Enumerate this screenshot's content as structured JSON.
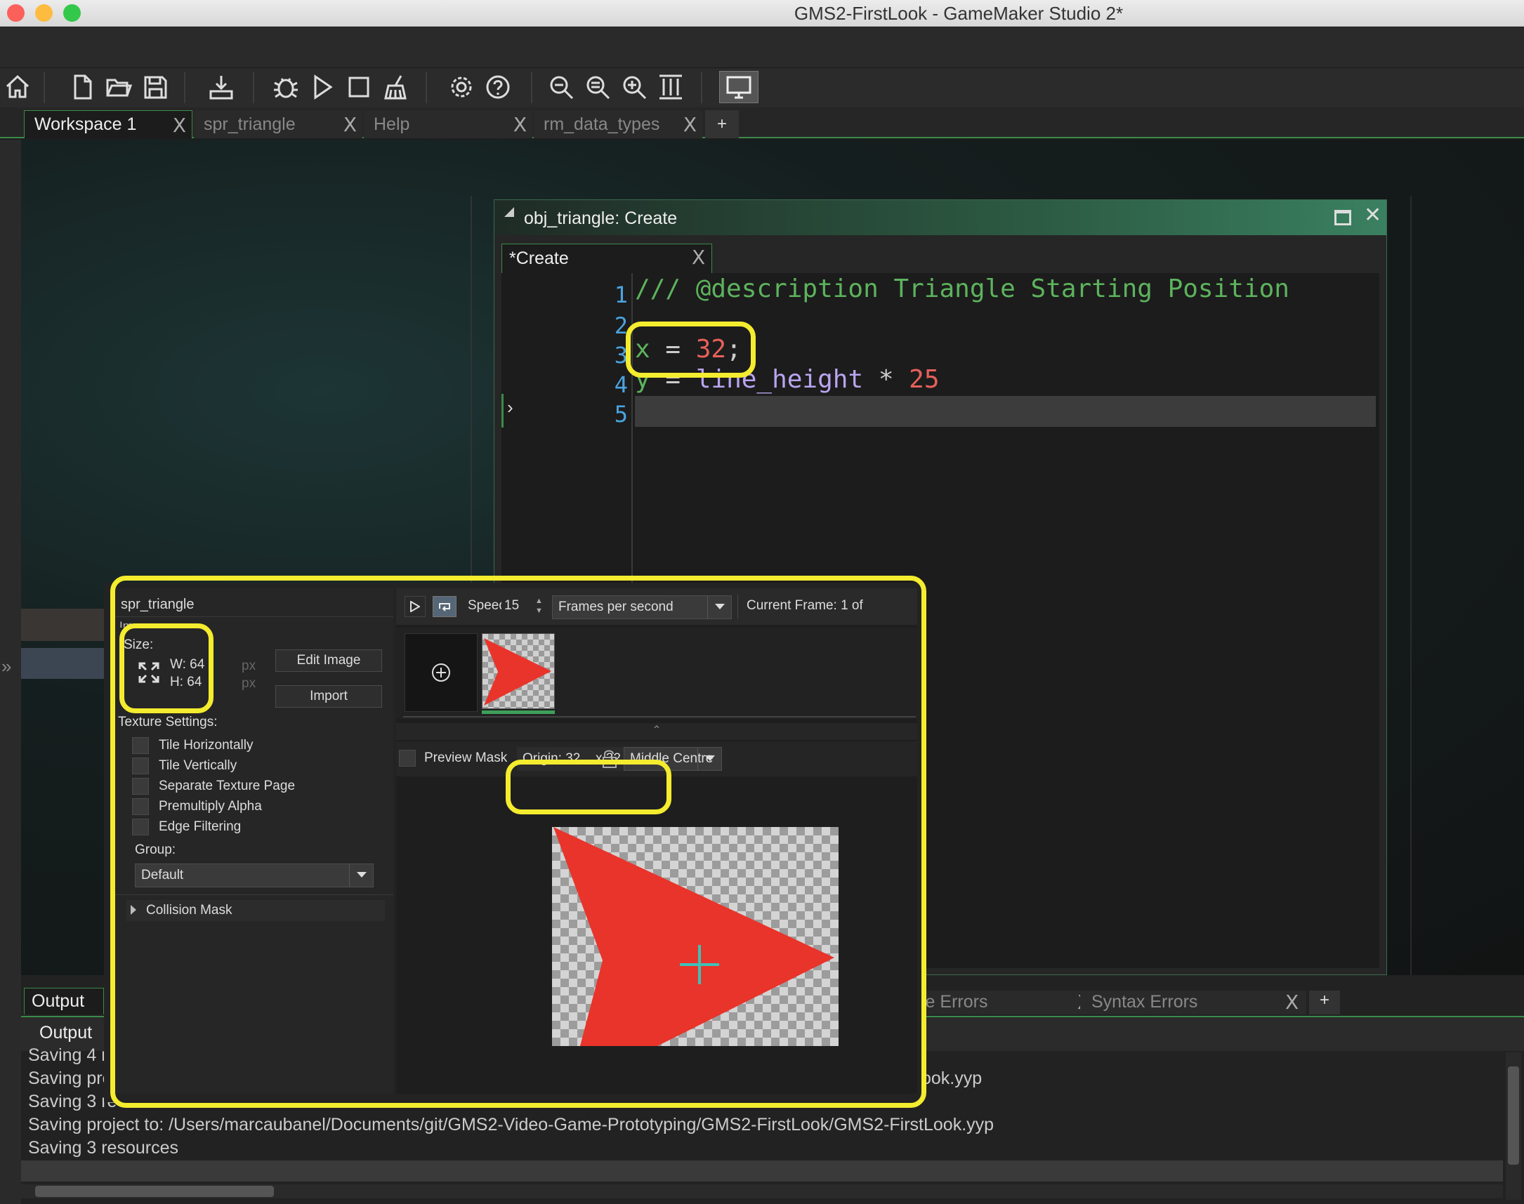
{
  "window": {
    "title": "GMS2-FirstLook - GameMaker Studio 2*"
  },
  "toolbar": {
    "icons": [
      "home-icon",
      "new-file-icon",
      "open-folder-icon",
      "save-icon",
      "export-icon",
      "debug-icon",
      "run-icon",
      "stop-icon",
      "clean-icon",
      "settings-icon",
      "help-icon",
      "zoom-out-icon",
      "zoom-reset-icon",
      "zoom-in-icon",
      "fit-icon",
      "display-icon"
    ]
  },
  "workspace_tabs": [
    {
      "label": "Workspace 1",
      "close": "X"
    },
    {
      "label": "spr_triangle",
      "close": "X"
    },
    {
      "label": "Help",
      "close": "X"
    },
    {
      "label": "rm_data_types",
      "close": "X"
    }
  ],
  "add_tab": "+",
  "side_arrow": "»",
  "code_window": {
    "title": "obj_triangle: Create",
    "tab": "*Create",
    "tab_close": "X",
    "caret_marker": "›",
    "line_numbers": [
      "1",
      "2",
      "3",
      "4",
      "5"
    ],
    "comment": "/// @description Triangle Starting Position",
    "line3_var": "x",
    "line3_op": " = ",
    "line3_num": "32",
    "line3_end": ";",
    "line4_var": "y",
    "line4_op": " = ",
    "line4_ident": "line_height",
    "line4_mul": " * ",
    "line4_num": "25"
  },
  "sprite": {
    "name": "spr_triangle",
    "image_label": "Image:",
    "size_label": "Size:",
    "width": "W: 64",
    "height": "H: 64",
    "px1": "px",
    "px2": "px",
    "edit_image": "Edit Image",
    "import": "Import",
    "texture_label": "Texture Settings:",
    "checkboxes": [
      "Tile Horizontally",
      "Tile Vertically",
      "Separate Texture Page",
      "Premultiply Alpha",
      "Edge Filtering"
    ],
    "group_label": "Group:",
    "group_value": "Default",
    "collision_mask": "Collision Mask",
    "speed_label": "Speed:",
    "speed_value": "15",
    "speed_unit": "Frames per second",
    "current_frame": "Current Frame: 1 of",
    "preview_mask": "Preview Mask",
    "origin_x": "Origin: 32",
    "origin_y": "x 32",
    "origin_mode": "Middle Centre",
    "scroll_up": "⌃"
  },
  "output": {
    "tab": "Output",
    "subheader": "Output",
    "tab2": "le Errors",
    "tab2_close": "X",
    "tab3": "Syntax Errors",
    "tab3_close": "X",
    "add_tab": "+",
    "lines": [
      "Saving 4 r",
      "Saving pro",
      "Saving 3 re",
      "Saving project to: /Users/marcaubanel/Documents/git/GMS2-Video-Game-Prototyping/GMS2-FirstLook/GMS2-FirstLook.yyp",
      "Saving 3 resources"
    ],
    "line2_tail": "ook.yyp"
  },
  "colors": {
    "highlight": "#f4ec2e",
    "comment": "#5db35d",
    "number": "#e8605a",
    "ident": "#b9a4f0"
  }
}
